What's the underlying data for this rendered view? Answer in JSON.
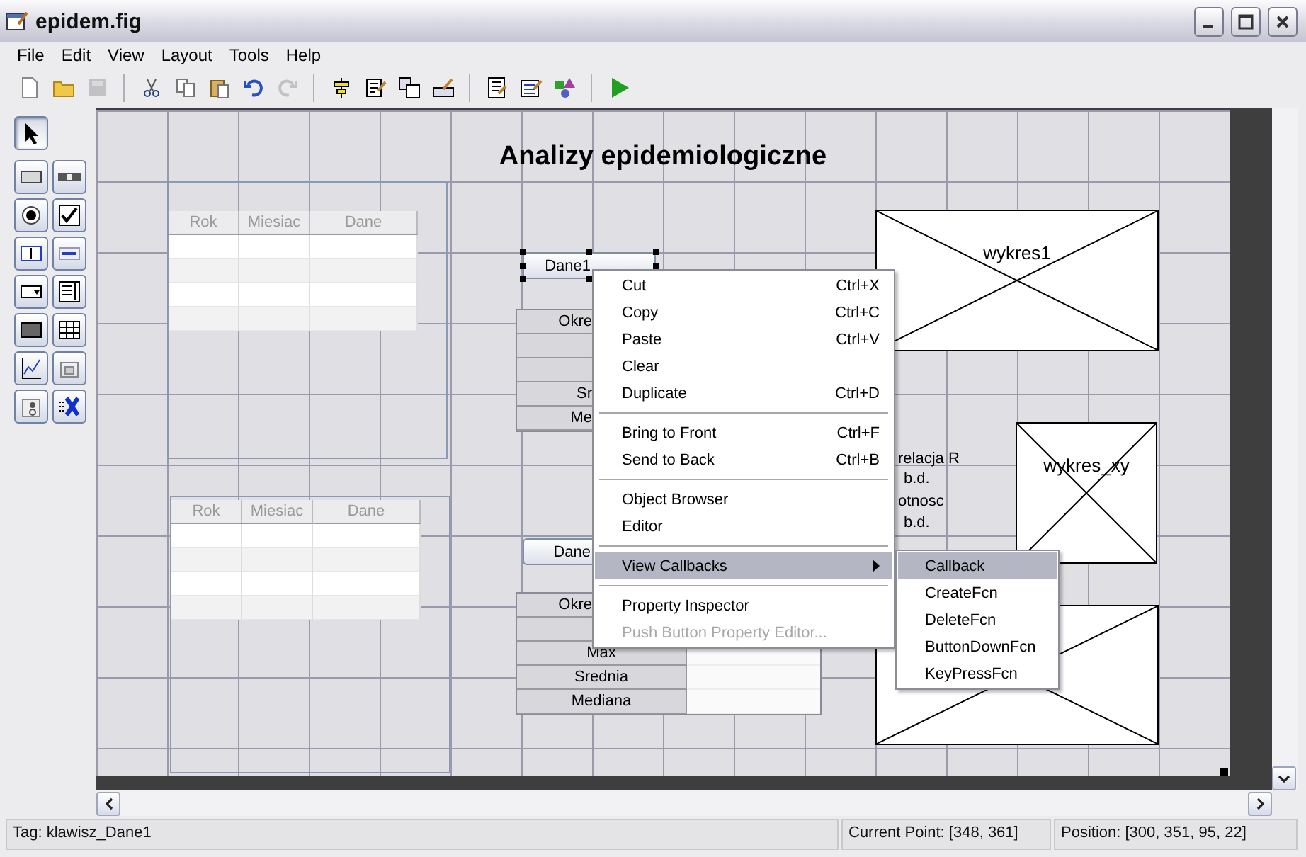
{
  "window": {
    "title": "epidem.fig"
  },
  "menu": [
    "File",
    "Edit",
    "View",
    "Layout",
    "Tools",
    "Help"
  ],
  "toolbar": [
    [
      {
        "kind": "new",
        "disabled": false
      },
      {
        "kind": "open",
        "disabled": false
      },
      {
        "kind": "save",
        "disabled": true
      }
    ],
    [
      {
        "kind": "cut",
        "disabled": false
      },
      {
        "kind": "copy",
        "disabled": false
      },
      {
        "kind": "paste",
        "disabled": false
      },
      {
        "kind": "undo",
        "disabled": false
      },
      {
        "kind": "redo",
        "disabled": true
      }
    ],
    [
      {
        "kind": "align",
        "disabled": false
      },
      {
        "kind": "menu_editor",
        "disabled": false
      },
      {
        "kind": "tab_order",
        "disabled": false
      },
      {
        "kind": "toolbar_editor",
        "disabled": false
      }
    ],
    [
      {
        "kind": "editor",
        "disabled": false
      },
      {
        "kind": "inspector",
        "disabled": false
      },
      {
        "kind": "browser",
        "disabled": false
      }
    ],
    [
      {
        "kind": "run",
        "disabled": false
      }
    ]
  ],
  "palette": [
    {
      "kind": "select",
      "selected": true
    },
    {
      "kind": "push_button",
      "selected": false
    },
    {
      "kind": "slider",
      "selected": false
    },
    {
      "kind": "radio",
      "selected": false
    },
    {
      "kind": "checkbox",
      "selected": false
    },
    {
      "kind": "edit",
      "selected": false
    },
    {
      "kind": "text",
      "selected": false
    },
    {
      "kind": "popup",
      "selected": false
    },
    {
      "kind": "listbox",
      "selected": false
    },
    {
      "kind": "toggle",
      "selected": false
    },
    {
      "kind": "table",
      "selected": false
    },
    {
      "kind": "axes",
      "selected": false
    },
    {
      "kind": "panel",
      "selected": false
    },
    {
      "kind": "button_group",
      "selected": false
    },
    {
      "kind": "activex",
      "selected": false
    }
  ],
  "canvas": {
    "heading": "Analizy epidemiologiczne",
    "panels": [
      {
        "columns": [
          "Rok",
          "Miesiac",
          "Dane"
        ]
      },
      {
        "columns": [
          "Rok",
          "Miesiac",
          "Dane"
        ]
      }
    ],
    "buttons": [
      {
        "label": "Dane1",
        "selected": true
      },
      {
        "label": "Dane",
        "selected": false
      }
    ],
    "stat_tables": [
      {
        "rows": [
          {
            "kind": "label",
            "label": "Okre"
          },
          {
            "kind": "blank"
          },
          {
            "kind": "blank"
          },
          {
            "kind": "label",
            "label": "Sr"
          },
          {
            "kind": "label",
            "label": "Me"
          }
        ]
      },
      {
        "rows": [
          {
            "kind": "label",
            "label": "Okre"
          },
          {
            "kind": "blank"
          },
          {
            "kind": "label",
            "label": "Max"
          },
          {
            "kind": "label",
            "label": "Srednia"
          },
          {
            "kind": "label",
            "label": "Mediana"
          }
        ]
      }
    ],
    "texts": [
      "relacja R",
      "b.d.",
      "otnosc",
      "b.d."
    ],
    "axes": [
      {
        "kind": "axes",
        "label": "wykres1"
      },
      {
        "kind": "axes",
        "label": "wykres_xy"
      },
      {
        "kind": "axes"
      }
    ]
  },
  "context_menu": [
    {
      "kind": "item",
      "label": "Cut",
      "shortcut": "Ctrl+X",
      "disabled": false
    },
    {
      "kind": "item",
      "label": "Copy",
      "shortcut": "Ctrl+C",
      "disabled": false
    },
    {
      "kind": "item",
      "label": "Paste",
      "shortcut": "Ctrl+V",
      "disabled": false
    },
    {
      "kind": "item",
      "label": "Clear",
      "disabled": false
    },
    {
      "kind": "item",
      "label": "Duplicate",
      "shortcut": "Ctrl+D",
      "disabled": false
    },
    {
      "kind": "separator"
    },
    {
      "kind": "item",
      "label": "Bring to Front",
      "shortcut": "Ctrl+F",
      "disabled": false
    },
    {
      "kind": "item",
      "label": "Send to Back",
      "shortcut": "Ctrl+B",
      "disabled": false
    },
    {
      "kind": "separator"
    },
    {
      "kind": "item",
      "label": "Object Browser",
      "disabled": false
    },
    {
      "kind": "item",
      "label": "Editor",
      "disabled": false
    },
    {
      "kind": "separator"
    },
    {
      "kind": "submenu",
      "label": "View Callbacks",
      "selected": true,
      "disabled": false
    },
    {
      "kind": "separator"
    },
    {
      "kind": "item",
      "label": "Property Inspector",
      "disabled": false
    },
    {
      "kind": "item",
      "label": "Push Button Property Editor...",
      "disabled": true
    }
  ],
  "submenu": [
    {
      "label": "Callback",
      "selected": true
    },
    {
      "label": "CreateFcn",
      "selected": false
    },
    {
      "label": "DeleteFcn",
      "selected": false
    },
    {
      "label": "ButtonDownFcn",
      "selected": false
    },
    {
      "label": "KeyPressFcn",
      "selected": false
    }
  ],
  "status_bar": {
    "tag": "Tag: klawisz_Dane1",
    "current_point": "Current Point:  [348, 361]",
    "position": "Position: [300, 351, 95, 22]"
  }
}
